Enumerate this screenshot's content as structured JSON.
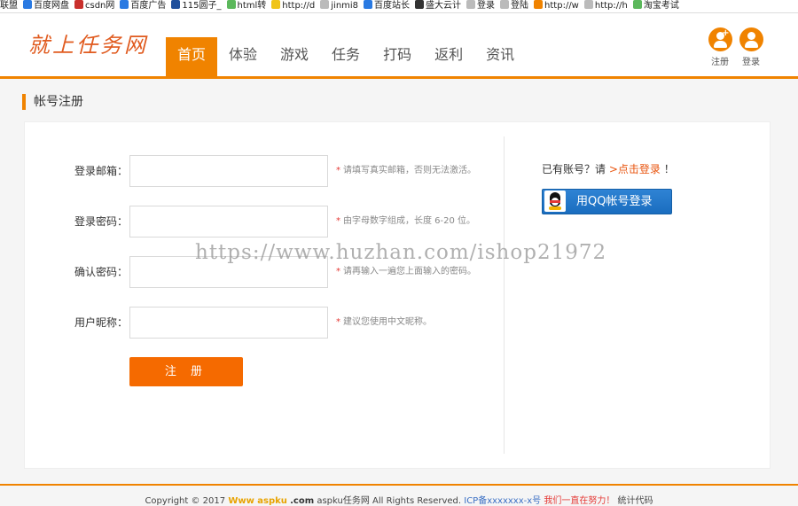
{
  "bookmarks": [
    {
      "label": "联盟",
      "color": ""
    },
    {
      "label": "百度网盘",
      "color": "#2a7ae2"
    },
    {
      "label": "csdn网",
      "color": "#c9302c"
    },
    {
      "label": "百度广告",
      "color": "#2a7ae2"
    },
    {
      "label": "115圆子_",
      "color": "#1f4f9c"
    },
    {
      "label": "html转",
      "color": "#5cb85c"
    },
    {
      "label": "http://d",
      "color": "#f0c419"
    },
    {
      "label": "jinmi8",
      "color": "#bbbbbb"
    },
    {
      "label": "百度站长",
      "color": "#2a7ae2"
    },
    {
      "label": "盛大云计",
      "color": "#333333"
    },
    {
      "label": "登录",
      "color": "#bbbbbb"
    },
    {
      "label": "登陆",
      "color": "#bbbbbb"
    },
    {
      "label": "http://w",
      "color": "#f08300"
    },
    {
      "label": "http://h",
      "color": "#bbbbbb"
    },
    {
      "label": "淘宝考试",
      "color": "#5cb85c"
    }
  ],
  "header": {
    "logo_text": "就上任务网",
    "nav": [
      {
        "label": "首页",
        "active": true
      },
      {
        "label": "体验",
        "active": false
      },
      {
        "label": "游戏",
        "active": false
      },
      {
        "label": "任务",
        "active": false
      },
      {
        "label": "打码",
        "active": false
      },
      {
        "label": "返利",
        "active": false
      },
      {
        "label": "资讯",
        "active": false
      }
    ],
    "register_label": "注册",
    "login_label": "登录"
  },
  "page_title": "帐号注册",
  "form": {
    "fields": [
      {
        "label": "登录邮箱：",
        "value": "",
        "hint": "请填写真实邮箱，否则无法激活。"
      },
      {
        "label": "登录密码：",
        "value": "",
        "hint": "由字母数字组成，长度 6-20 位。"
      },
      {
        "label": "确认密码：",
        "value": "",
        "hint": "请再输入一遍您上面输入的密码。"
      },
      {
        "label": "用户昵称：",
        "value": "",
        "hint": "建议您使用中文昵称。"
      }
    ],
    "hint_star": "*",
    "submit_label": "注 册"
  },
  "side": {
    "has_account_text": "已有账号？请",
    "login_link": ">点击登录",
    "suffix": "！",
    "qq_login_label": "用QQ帐号登录"
  },
  "watermark": "https://www.huzhan.com/ishop21972",
  "footer": {
    "copyright": "Copyright © 2017",
    "www": "Www aspku",
    "com": ".com",
    "site_name": "aspku任务网 All Rights Reserved.",
    "icp": "ICP备xxxxxxx-x号",
    "slogan": "我们一直在努力！",
    "stats": "统计代码"
  },
  "colors": {
    "accent": "#f08300",
    "submit": "#f56a00",
    "qq_blue": "#1a6dbf",
    "link_orange": "#e8540e"
  }
}
